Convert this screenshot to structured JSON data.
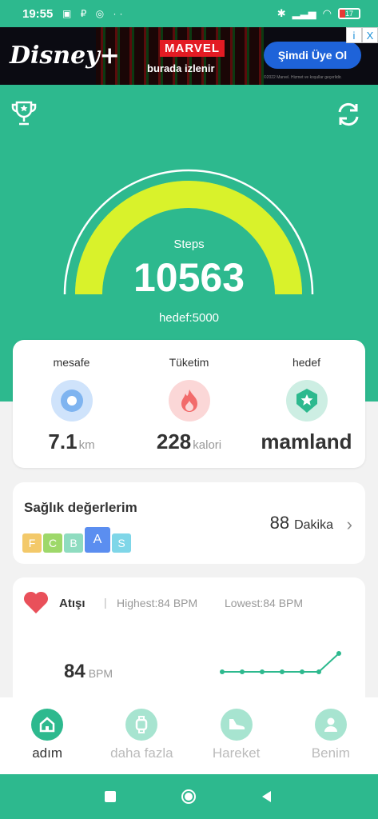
{
  "status_bar": {
    "time": "19:55",
    "battery": "17"
  },
  "ad": {
    "brand": "Disney+",
    "marvel": "MARVEL",
    "tagline": "burada izlenir",
    "cta": "Şimdi Üye Ol",
    "info_icon": "i",
    "close_icon": "X",
    "fine_print": "©2022 Marvel. Hizmet ve koşullar geçerlidir."
  },
  "steps": {
    "label": "Steps",
    "value": "10563",
    "goal": "hedef:5000",
    "progress": 1.0
  },
  "stats": [
    {
      "label": "mesafe",
      "value": "7.1",
      "unit": "km",
      "icon": "location-pin-icon"
    },
    {
      "label": "Tüketim",
      "value": "228",
      "unit": "kalori",
      "icon": "flame-icon"
    },
    {
      "label": "hedef",
      "value": "mamland",
      "unit": "",
      "icon": "badge-star-icon"
    }
  ],
  "health": {
    "title": "Sağlık değerlerim",
    "grades": [
      "F",
      "C",
      "B",
      "A",
      "S"
    ],
    "grade_colors": [
      "#f3c96a",
      "#9ed86a",
      "#8fdcc0",
      "#5b8ef0",
      "#7fd6e8"
    ],
    "selected_grade": "A",
    "duration_value": "88",
    "duration_unit": "Dakika"
  },
  "heart_rate": {
    "title": "Atışı",
    "highest": "Highest:84  BPM",
    "lowest": "Lowest:84  BPM",
    "value": "84",
    "unit": "BPM"
  },
  "nav": [
    {
      "label": "adım",
      "active": true,
      "icon": "home-icon"
    },
    {
      "label": "daha fazla",
      "active": false,
      "icon": "watch-icon"
    },
    {
      "label": "Hareket",
      "active": false,
      "icon": "shoe-icon"
    },
    {
      "label": "Benim",
      "active": false,
      "icon": "person-icon"
    }
  ],
  "colors": {
    "brand": "#2db98e",
    "gauge": "#d9f22b"
  }
}
